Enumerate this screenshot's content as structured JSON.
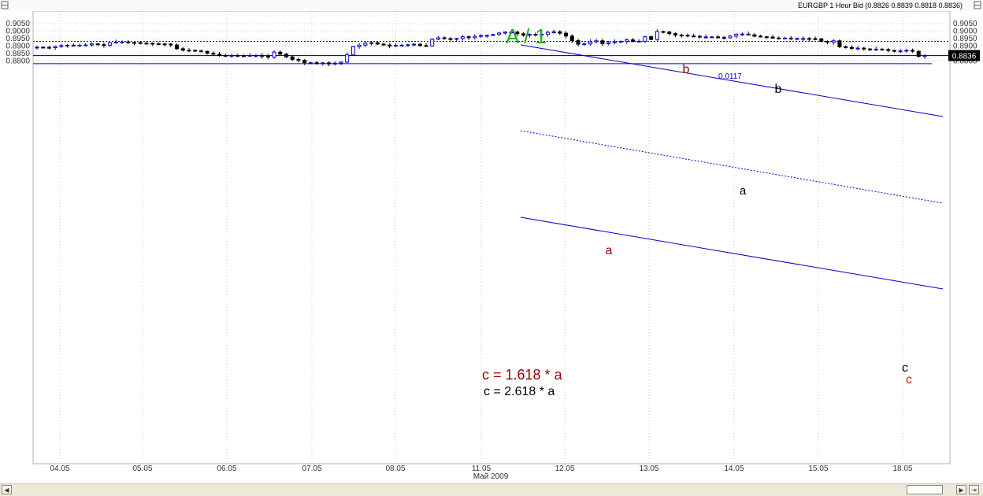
{
  "header": {
    "title": "EURGBP 1 Hour Bid (0.8826 0.8839 0.8818 0.8836)",
    "settings_icon": "settings-icon"
  },
  "chart_data": {
    "type": "candlestick",
    "symbol": "EURGBP",
    "timeframe": "1 Hour",
    "price_type": "Bid",
    "ohlc_last": {
      "open": 0.8826,
      "high": 0.8839,
      "low": 0.8818,
      "close": 0.8836
    },
    "current_price_label": "0.8836",
    "y_ticks": [
      "0.9050",
      "0.9000",
      "0.8950",
      "0.8900",
      "0.8850",
      "0.8800"
    ],
    "ylim": [
      0.876,
      0.9058
    ],
    "x_ticks": [
      "04.05",
      "05.05",
      "06.05",
      "07.05",
      "08.05",
      "11.05",
      "12.05",
      "13.05",
      "14.05",
      "15.05",
      "18.05"
    ],
    "xlabel": "Май 2009",
    "grid": true,
    "closes": [
      0.8892,
      0.8891,
      0.8889,
      0.8897,
      0.8903,
      0.8905,
      0.8904,
      0.8905,
      0.8907,
      0.8914,
      0.8909,
      0.8905,
      0.8922,
      0.8926,
      0.8927,
      0.8923,
      0.8922,
      0.8919,
      0.8918,
      0.8915,
      0.8914,
      0.8913,
      0.8907,
      0.8882,
      0.8872,
      0.8871,
      0.8867,
      0.8864,
      0.8852,
      0.8845,
      0.8837,
      0.8836,
      0.8837,
      0.8835,
      0.8834,
      0.8837,
      0.8837,
      0.8831,
      0.8826,
      0.8859,
      0.8845,
      0.8827,
      0.881,
      0.8804,
      0.8788,
      0.8788,
      0.8786,
      0.8787,
      0.878,
      0.8785,
      0.8792,
      0.8841,
      0.8895,
      0.8906,
      0.8918,
      0.8922,
      0.8913,
      0.8907,
      0.89,
      0.8904,
      0.8905,
      0.8908,
      0.8912,
      0.8903,
      0.89,
      0.8945,
      0.8955,
      0.8949,
      0.8945,
      0.895,
      0.8962,
      0.8956,
      0.8965,
      0.897,
      0.8971,
      0.8977,
      0.8987,
      0.8993,
      0.8993,
      0.8982,
      0.8972,
      0.8978,
      0.8974,
      0.8978,
      0.8992,
      0.8995,
      0.8986,
      0.8967,
      0.8936,
      0.8912,
      0.8914,
      0.8928,
      0.8935,
      0.8915,
      0.8923,
      0.8929,
      0.8931,
      0.8941,
      0.8931,
      0.8932,
      0.8962,
      0.8944,
      0.8997,
      0.8994,
      0.8983,
      0.8973,
      0.8972,
      0.8967,
      0.8965,
      0.896,
      0.8961,
      0.8961,
      0.8957,
      0.8955,
      0.8966,
      0.8979,
      0.898,
      0.8975,
      0.8966,
      0.8962,
      0.896,
      0.8953,
      0.8952,
      0.8953,
      0.895,
      0.895,
      0.895,
      0.8949,
      0.8948,
      0.8931,
      0.8925,
      0.8935,
      0.8895,
      0.889,
      0.8884,
      0.8886,
      0.888,
      0.8878,
      0.8879,
      0.8876,
      0.887,
      0.8866,
      0.8867,
      0.8871,
      0.8865,
      0.883,
      0.8836
    ],
    "horizontal_lines": [
      {
        "price": 0.8931,
        "style": "dotted",
        "color": "#0000cc",
        "name": "support-resistance"
      },
      {
        "price": 0.8836,
        "style": "solid",
        "color": "#000000",
        "name": "current-price"
      },
      {
        "price": 0.8782,
        "style": "solid",
        "color": "#0000cc",
        "name": "low"
      }
    ],
    "trend_channel": {
      "color": "#0000cc",
      "distance_label": "0.0117"
    },
    "annotations": [
      {
        "text": "A / 1",
        "color": "#22aa22"
      },
      {
        "text": "b",
        "color": "#990000"
      },
      {
        "text": "a",
        "color": "#990000"
      },
      {
        "text": "b",
        "color": "#000000"
      },
      {
        "text": "a",
        "color": "#000000"
      },
      {
        "text": "c",
        "color": "#000000"
      },
      {
        "text": "c",
        "color": "#cc2222"
      }
    ],
    "formula_red": "c = 1.618 * a",
    "formula_black": "c = 2.618 * a"
  },
  "colors": {
    "bull": "#0000cc",
    "bear": "#000000",
    "grid": "#c8c8c8",
    "price_tag_bg": "#000000",
    "price_tag_fg": "#ffffff"
  },
  "scrollbar": {
    "left_icon": "arrow-left-icon",
    "right_icon": "arrow-right-icon",
    "end_icon": "go-to-end-icon"
  }
}
